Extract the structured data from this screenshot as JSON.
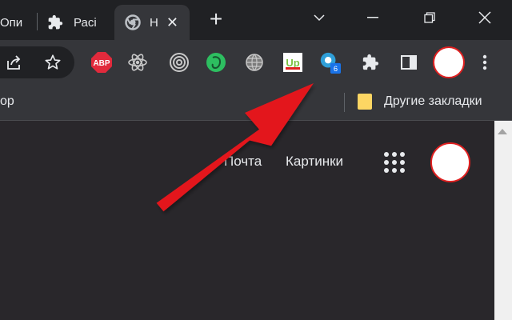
{
  "tabs": [
    {
      "label": "Опи"
    },
    {
      "label": "Расі"
    },
    {
      "label": "Н"
    }
  ],
  "toolbar": {
    "extensions": [
      {
        "name": "adblock-plus",
        "label": "ABP",
        "color": "#e12a3c"
      },
      {
        "name": "react-devtools"
      },
      {
        "name": "target-extension"
      },
      {
        "name": "evernote-extension",
        "color": "#2dbe60"
      },
      {
        "name": "globe-extension"
      },
      {
        "name": "up-extension",
        "label": "Up",
        "color": "#7ac142"
      },
      {
        "name": "badged-extension",
        "badge": "6",
        "badge_color": "#1a73e8"
      }
    ]
  },
  "bookmarks": {
    "left_fragment": "ор",
    "other": "Другие закладки"
  },
  "page": {
    "links": [
      "Почта",
      "Картинки"
    ]
  },
  "colors": {
    "arrow": "#e3191c",
    "accent": "#e02020"
  }
}
